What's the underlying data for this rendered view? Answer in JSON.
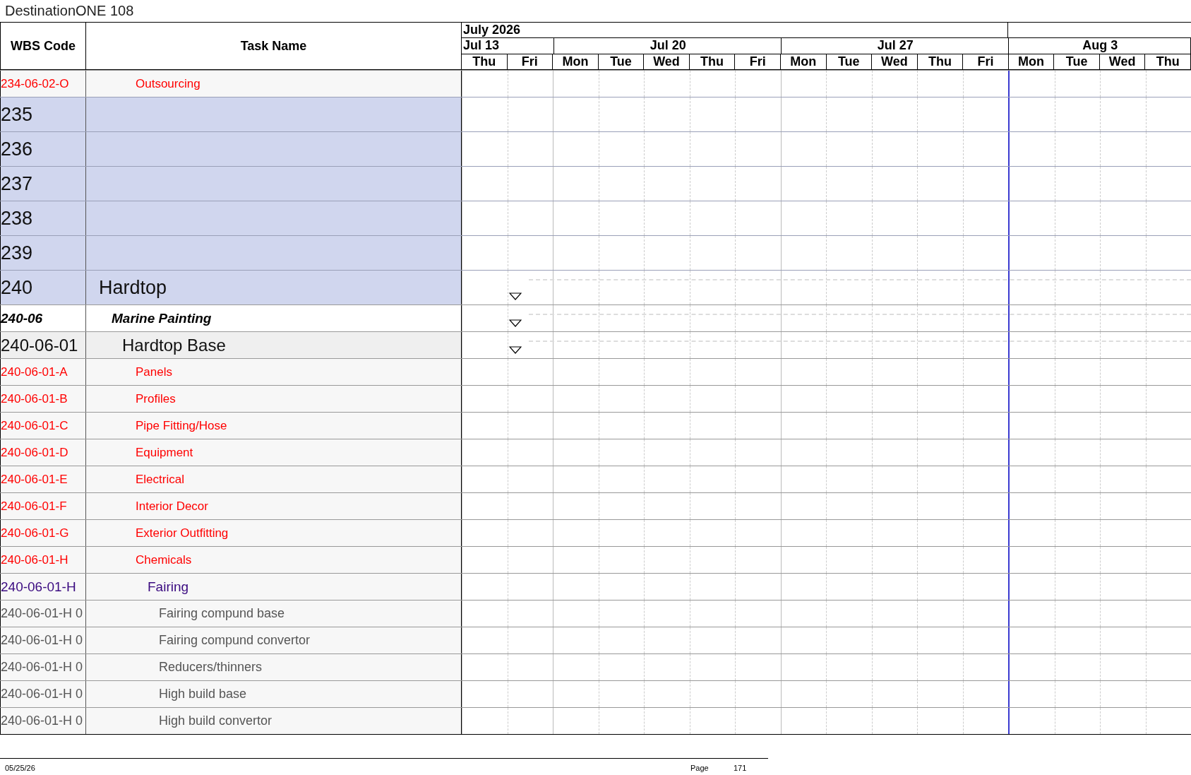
{
  "title": "DestinationONE 108",
  "columns": {
    "wbs": "WBS Code",
    "task": "Task Name"
  },
  "months": [
    {
      "label": "July 2026",
      "weeks": [
        {
          "label": "Jul 13",
          "days": [
            "Thu",
            "Fri"
          ]
        },
        {
          "label": "Jul 20",
          "days": [
            "Mon",
            "Tue",
            "Wed",
            "Thu",
            "Fri"
          ]
        },
        {
          "label": "Jul 27",
          "days": [
            "Mon",
            "Tue",
            "Wed",
            "Thu",
            "Fri"
          ]
        }
      ]
    },
    {
      "weeks": [
        {
          "label": "Aug 3",
          "days": [
            "Mon",
            "Tue",
            "Wed",
            "Thu"
          ]
        }
      ]
    }
  ],
  "rows": [
    {
      "kind": "task",
      "wbs": "234-06-02-O",
      "name": "Outsourcing",
      "milestone": false
    },
    {
      "kind": "blank",
      "wbs": "235",
      "milestone": false
    },
    {
      "kind": "blank",
      "wbs": "236",
      "milestone": false
    },
    {
      "kind": "blank",
      "wbs": "237",
      "milestone": false
    },
    {
      "kind": "blank",
      "wbs": "238",
      "milestone": false
    },
    {
      "kind": "blank",
      "wbs": "239",
      "milestone": false
    },
    {
      "kind": "area",
      "wbs": "240",
      "name": "Hardtop",
      "milestone": true,
      "children": [
        {
          "kind": "phase",
          "wbs": "240-06",
          "name": "Marine Painting",
          "milestone": true,
          "children": [
            {
              "kind": "group",
              "wbs": "240-06-01",
              "name": "Hardtop Base",
              "milestone": true,
              "children": [
                {
                  "kind": "task",
                  "wbs": "240-06-01-A",
                  "name": "Panels",
                  "milestone": false
                },
                {
                  "kind": "task",
                  "wbs": "240-06-01-B",
                  "name": "Profiles",
                  "milestone": false
                },
                {
                  "kind": "task",
                  "wbs": "240-06-01-C",
                  "name": "Pipe Fitting/Hose",
                  "milestone": false
                },
                {
                  "kind": "task",
                  "wbs": "240-06-01-D",
                  "name": "Equipment",
                  "milestone": false
                },
                {
                  "kind": "task",
                  "wbs": "240-06-01-E",
                  "name": "Electrical",
                  "milestone": false
                },
                {
                  "kind": "task",
                  "wbs": "240-06-01-F",
                  "name": "Interior Decor",
                  "milestone": false
                },
                {
                  "kind": "task",
                  "wbs": "240-06-01-G",
                  "name": "Exterior Outfitting",
                  "milestone": false
                },
                {
                  "kind": "task",
                  "wbs": "240-06-01-H",
                  "name": "Chemicals",
                  "milestone": false
                },
                {
                  "kind": "subgroup",
                  "wbs": "240-06-01-H",
                  "name": "Fairing",
                  "milestone": false,
                  "children": [
                    {
                      "kind": "item",
                      "wbs": "240-06-01-H 0",
                      "name": "Fairing compund base",
                      "milestone": false
                    },
                    {
                      "kind": "item",
                      "wbs": "240-06-01-H 0",
                      "name": "Fairing compund convertor",
                      "milestone": false
                    },
                    {
                      "kind": "item",
                      "wbs": "240-06-01-H 0",
                      "name": "Reducers/thinners",
                      "milestone": false
                    },
                    {
                      "kind": "item",
                      "wbs": "240-06-01-H 0",
                      "name": "High build base",
                      "milestone": false
                    },
                    {
                      "kind": "item",
                      "wbs": "240-06-01-H 0",
                      "name": "High build convertor",
                      "milestone": false
                    }
                  ]
                }
              ]
            }
          ]
        }
      ]
    }
  ],
  "footer": {
    "date": "05/25/26",
    "page_label": "Page",
    "page_number": "171"
  }
}
